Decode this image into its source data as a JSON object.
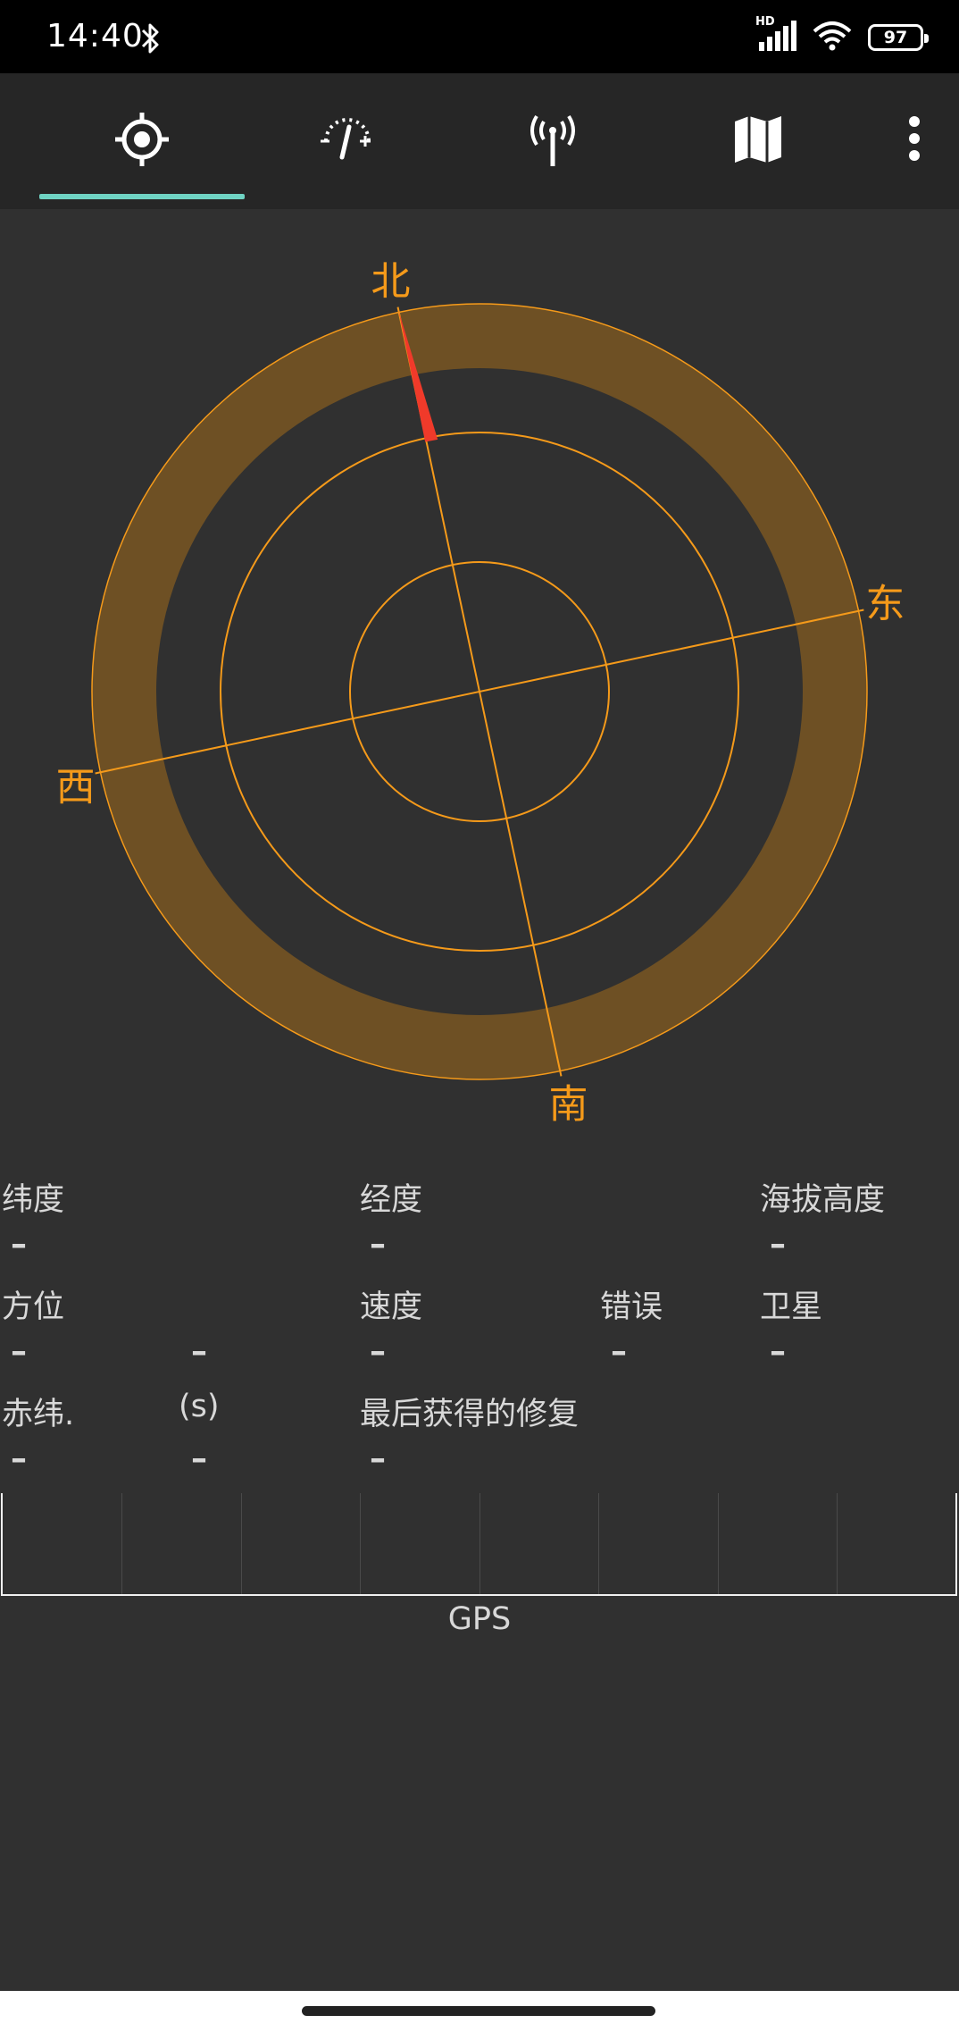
{
  "status_bar": {
    "time": "14:40",
    "hd": "HD",
    "battery": "97",
    "icons": [
      "bluetooth-icon",
      "signal-icon",
      "wifi-icon",
      "battery-icon"
    ]
  },
  "tabs": [
    {
      "icon": "location-target-icon",
      "active": true
    },
    {
      "icon": "speedometer-icon",
      "active": false
    },
    {
      "icon": "antenna-icon",
      "active": false
    },
    {
      "icon": "map-icon",
      "active": false
    }
  ],
  "menu_icon": "more-vertical-icon",
  "compass": {
    "north": "北",
    "east": "东",
    "south": "南",
    "west": "西",
    "color": "#f59a1a",
    "needle_color": "#f03a2a",
    "heading_deg": 12
  },
  "info": {
    "latitude_label": "纬度",
    "latitude_value": "–",
    "longitude_label": "经度",
    "longitude_value": "–",
    "altitude_label": "海拔高度",
    "altitude_value": "–",
    "bearing_label": "方位",
    "bearing_value": "–",
    "bearing_value2": "–",
    "speed_label": "速度",
    "speed_value": "–",
    "error_label": "错误",
    "error_value": "–",
    "satellites_label": "卫星",
    "satellites_value": "–",
    "declination_label": "赤纬.",
    "declination_value": "–",
    "seconds_label": "(s)",
    "seconds_value": "–",
    "last_fix_label": "最后获得的修复",
    "last_fix_value": "–"
  },
  "signal": {
    "label": "GPS"
  }
}
